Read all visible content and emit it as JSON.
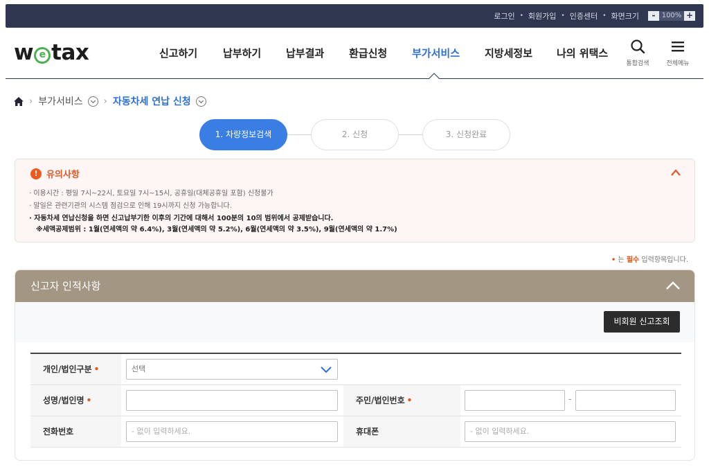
{
  "topbar": {
    "links": [
      "로그인",
      "회원가입",
      "인증센터",
      "화면크기"
    ],
    "zoom_minus": "-",
    "zoom_value": "100%",
    "zoom_plus": "+"
  },
  "header": {
    "logo_w": "w",
    "logo_e": "e",
    "logo_rest": "tax",
    "nav": [
      "신고하기",
      "납부하기",
      "납부결과",
      "환급신청",
      "부가서비스",
      "지방세정보",
      "나의 위택스"
    ],
    "active_nav": "부가서비스",
    "search_label": "통합검색",
    "menu_label": "전체메뉴"
  },
  "breadcrumb": {
    "level1": "부가서비스",
    "current": "자동차세 연납 신청"
  },
  "steps": [
    "1. 차량정보검색",
    "2. 신청",
    "3. 신청완료"
  ],
  "notice": {
    "title": "유의사항",
    "items": [
      "· 이용시간 : 평일 7시~22시, 토요일 7시~15시, 공휴일(대체공휴일 포함) 신청불가",
      "· 말일은 관련기관의 시스템 점검으로 인해 19시까지 신청 가능합니다.",
      "· 자동차세 연납신청을 하면 신고납부기한 이후의 기간에 대해서 100분의 10의 범위에서 공제받습니다.",
      "※세액공제범위 : 1월(연세액의 약 6.4%), 3월(연세액의 약 5.2%), 6월(연세액의 약 3.5%), 9월(연세액의 약 1.7%)"
    ]
  },
  "required_note": {
    "bullet": "•",
    "prefix": " 는 ",
    "word": "필수",
    "suffix": " 입력항목입니다."
  },
  "form": {
    "title": "신고자 인적사항",
    "lookup_button": "비회원 신고조회",
    "type_label": "개인/법인구분",
    "type_value": "선택",
    "name_label": "성명/법인명",
    "id_label": "주민/법인번호",
    "id_sep": "-",
    "phone_label": "전화번호",
    "phone_placeholder": "- 없이 입력하세요.",
    "mobile_label": "휴대폰",
    "mobile_placeholder": "- 없이 입력하세요.",
    "required_star": "•"
  },
  "colors": {
    "accent": "#3a7ee4",
    "panel_header": "#a39784",
    "notice_red": "#e05a2b",
    "topbar": "#2f3650"
  }
}
